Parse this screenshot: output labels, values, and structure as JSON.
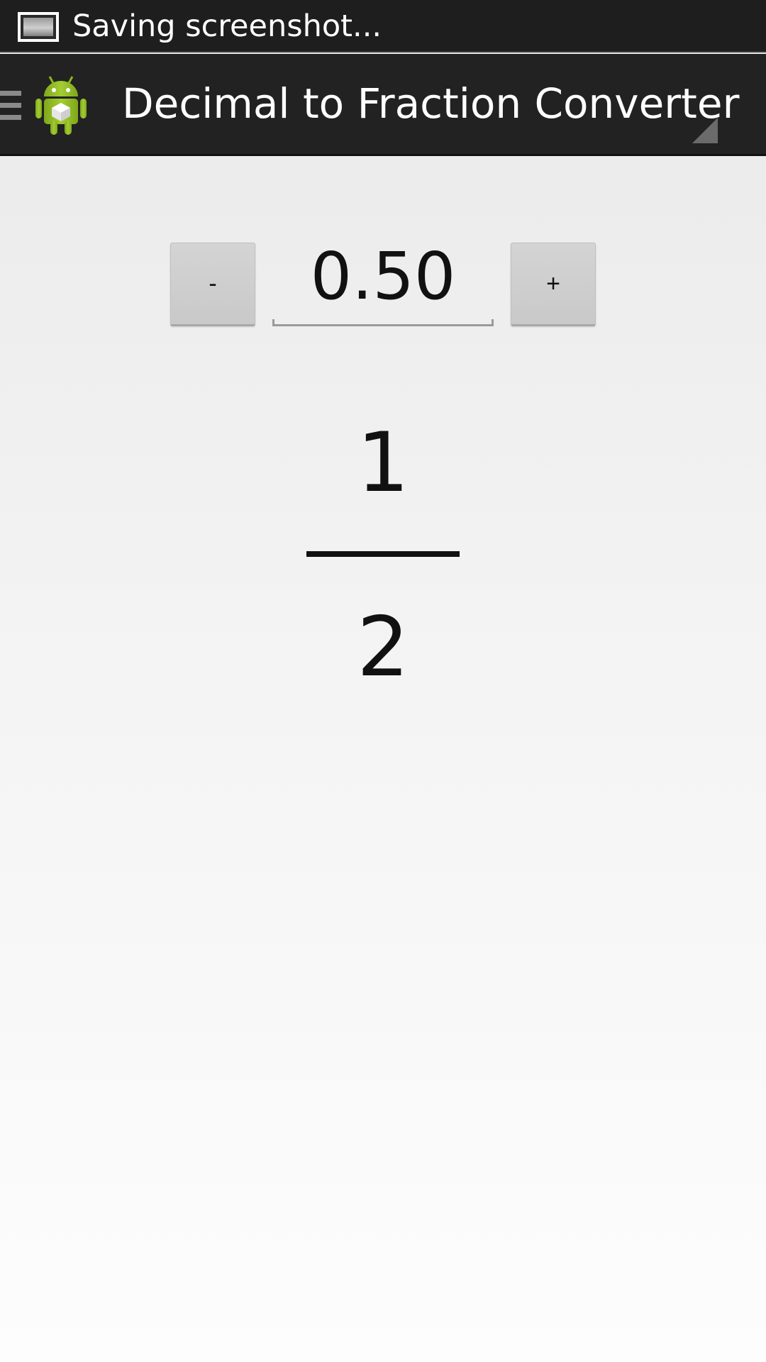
{
  "status_bar": {
    "notification_icon": "screenshot-icon",
    "text": "Saving screenshot..."
  },
  "action_bar": {
    "drawer_icon": "drawer-menu-icon",
    "app_icon": "android-robot-icon",
    "title": "Decimal to Fraction Converter",
    "overflow_icon": "overflow-triangle-icon"
  },
  "converter": {
    "minus_label": "-",
    "plus_label": "+",
    "decimal_value": "0.50",
    "numerator": "1",
    "denominator": "2"
  },
  "colors": {
    "status_bar_bg": "#1e1e1e",
    "action_bar_bg": "#222222",
    "android_green": "#97c024",
    "button_gray": "#cfcfcf",
    "text": "#111111"
  }
}
